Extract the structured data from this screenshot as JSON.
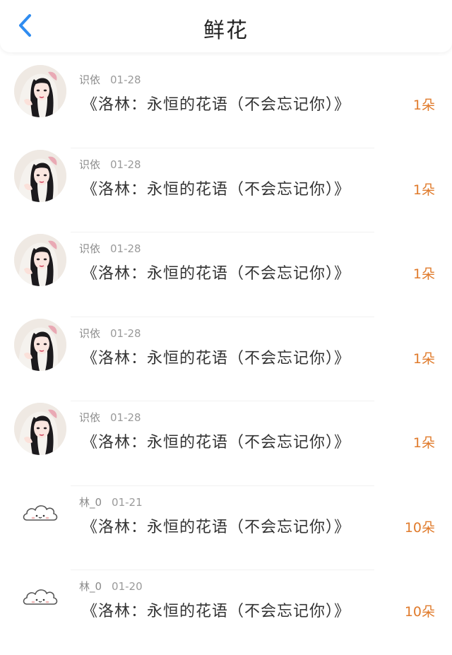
{
  "header": {
    "title": "鲜花"
  },
  "gifts": [
    {
      "user": "识依",
      "date": "01-28",
      "description": "《洛林：永恒的花语（不会忘记你）》",
      "count": "1朵",
      "avatar": "portrait-avatar"
    },
    {
      "user": "识依",
      "date": "01-28",
      "description": "《洛林：永恒的花语（不会忘记你）》",
      "count": "1朵",
      "avatar": "portrait-avatar"
    },
    {
      "user": "识依",
      "date": "01-28",
      "description": "《洛林：永恒的花语（不会忘记你）》",
      "count": "1朵",
      "avatar": "portrait-avatar"
    },
    {
      "user": "识依",
      "date": "01-28",
      "description": "《洛林：永恒的花语（不会忘记你）》",
      "count": "1朵",
      "avatar": "portrait-avatar"
    },
    {
      "user": "识依",
      "date": "01-28",
      "description": "《洛林：永恒的花语（不会忘记你）》",
      "count": "1朵",
      "avatar": "portrait-avatar"
    },
    {
      "user": "林_0",
      "date": "01-21",
      "description": "《洛林：永恒的花语（不会忘记你）》",
      "count": "10朵",
      "avatar": "cloud-avatar"
    },
    {
      "user": "林_0",
      "date": "01-20",
      "description": "《洛林：永恒的花语（不会忘记你）》",
      "count": "10朵",
      "avatar": "cloud-avatar"
    }
  ],
  "colors": {
    "accent": "#e07b2c",
    "back_arrow": "#2f8cf0"
  }
}
